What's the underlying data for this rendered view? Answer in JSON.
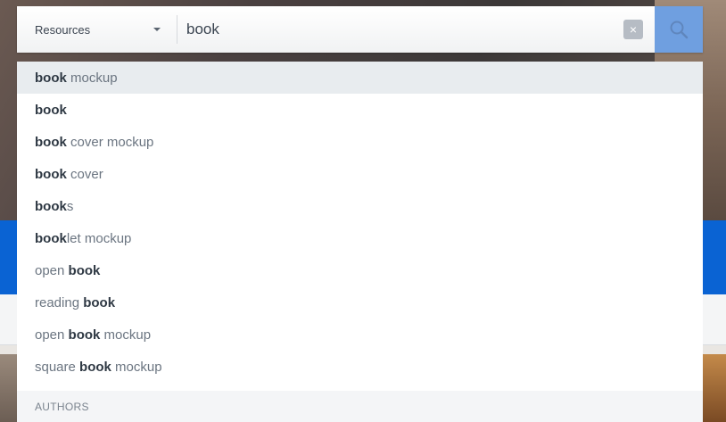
{
  "search": {
    "category": "Resources",
    "query": "book",
    "clear_symbol": "×"
  },
  "suggestions": [
    {
      "pre": "",
      "match": "book",
      "post": " mockup",
      "active": true
    },
    {
      "pre": "",
      "match": "book",
      "post": ""
    },
    {
      "pre": "",
      "match": "book",
      "post": " cover mockup"
    },
    {
      "pre": "",
      "match": "book",
      "post": " cover"
    },
    {
      "pre": "",
      "match": "book",
      "post": "s"
    },
    {
      "pre": "",
      "match": "book",
      "post": "let mockup"
    },
    {
      "pre": "open ",
      "match": "book",
      "post": ""
    },
    {
      "pre": "reading ",
      "match": "book",
      "post": ""
    },
    {
      "pre": "open ",
      "match": "book",
      "post": " mockup"
    },
    {
      "pre": "square ",
      "match": "book",
      "post": " mockup"
    }
  ],
  "authors_header": "AUTHORS",
  "colors": {
    "search_button": "#6f9fe0",
    "active_row": "#e8ecef",
    "brand_band": "#0a63d3"
  },
  "icons": {
    "category_caret": "chevron-down-icon",
    "clear": "close-icon",
    "search": "search-icon"
  }
}
